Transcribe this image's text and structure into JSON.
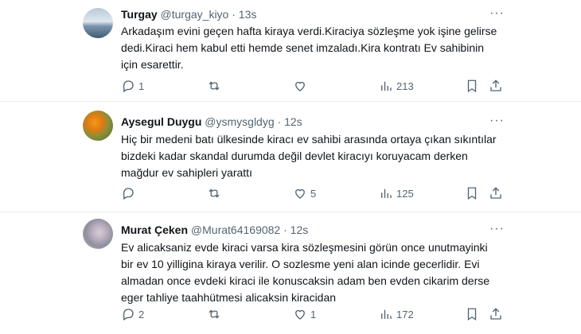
{
  "tweets": [
    {
      "name": "Turgay",
      "handle": "@turgay_kiyo",
      "separator": "·",
      "time": "13s",
      "text": "Arkadaşım evini geçen hafta kiraya verdi.Kiraciya sözleşme yok işine gelirse dedi.Kiraci hem kabul etti hemde senet imzaladı.Kira kontratı Ev sahibinin için esarettir.",
      "replies": "1",
      "retweets": "",
      "likes": "",
      "views": "213"
    },
    {
      "name": "Aysegul Duygu",
      "handle": "@ysmysgldyg",
      "separator": "·",
      "time": "12s",
      "text": "Hiç bir medeni batı ülkesinde kiracı ev sahibi arasında ortaya çıkan sıkıntılar bizdeki kadar skandal durumda değil devlet kiracıyı koruyacam derken mağdur ev sahipleri yarattı",
      "replies": "",
      "retweets": "",
      "likes": "5",
      "views": "125"
    },
    {
      "name": "Murat Çeken",
      "handle": "@Murat64169082",
      "separator": "·",
      "time": "12s",
      "text": "Ev alicaksaniz evde kiraci varsa kira sözleşmesini görün once unutmayinki bir ev 10 yilligina kiraya verilir. O sozlesme yeni alan icinde gecerlidir. Evi almadan once evdeki kiraci ile konuscaksin adam ben evden cikarim derse eger tahliye taahhütmesi alicaksin kiracidan",
      "replies": "2",
      "retweets": "",
      "likes": "1",
      "views": "172"
    }
  ],
  "icons": {
    "more": "more-horizontal-icon",
    "reply": "reply-icon",
    "retweet": "retweet-icon",
    "like": "heart-icon",
    "views": "views-chart-icon",
    "bookmark": "bookmark-icon",
    "share": "share-icon"
  },
  "colors": {
    "text": "#0f1419",
    "secondary": "#536471",
    "divider": "#e6ecf0"
  }
}
